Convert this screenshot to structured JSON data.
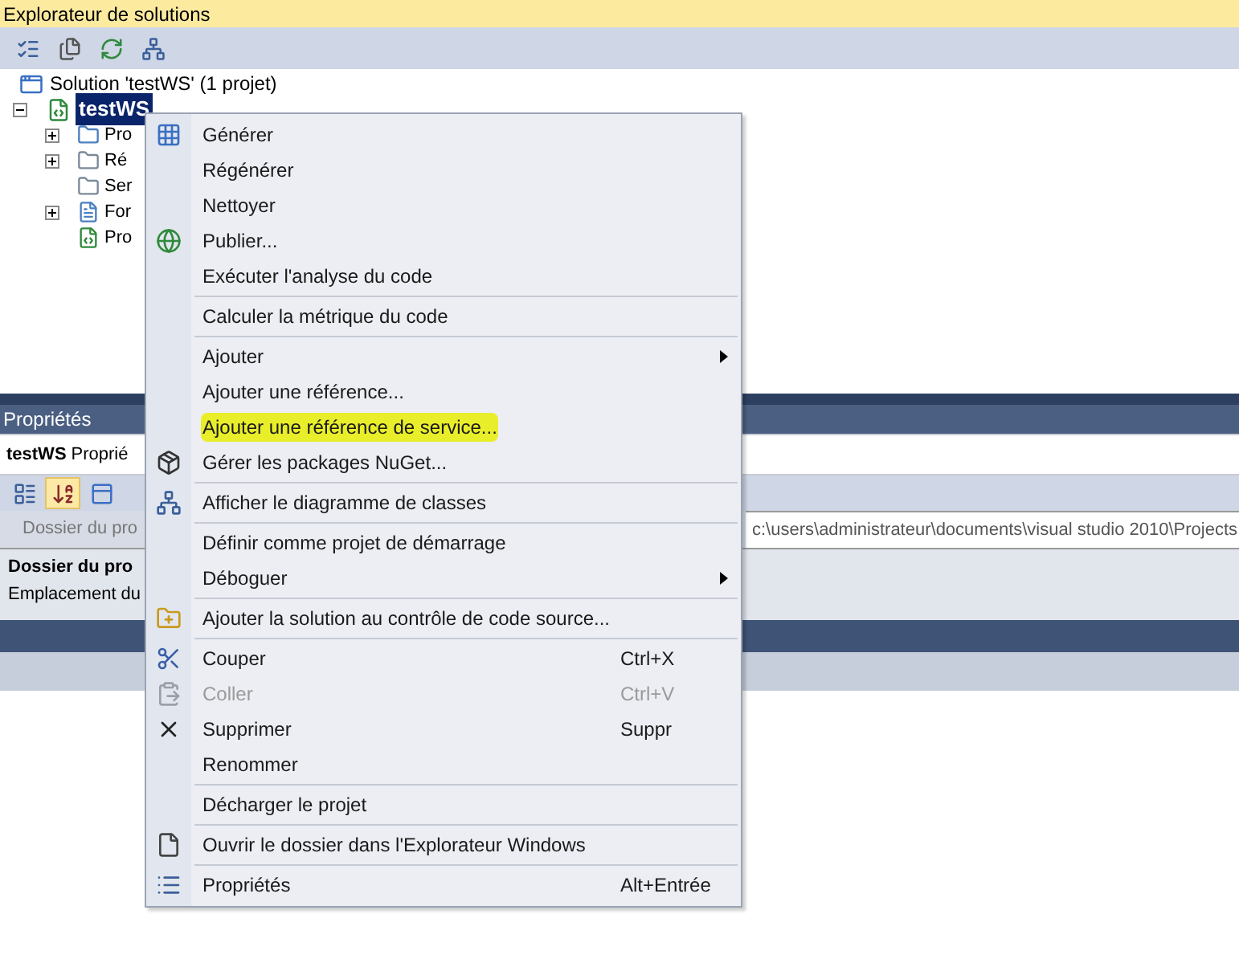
{
  "explorer": {
    "title": "Explorateur de solutions",
    "tree": {
      "label": "Solution 'testWS' (1 projet)",
      "children": [
        {
          "label": "testWS",
          "selected": true,
          "expanded": true,
          "children": [
            {
              "label": "Pro",
              "expanded": false
            },
            {
              "label": "Ré",
              "expanded": false
            },
            {
              "label": "Ser"
            },
            {
              "label": "For",
              "expanded": false
            },
            {
              "label": "Pro"
            }
          ]
        }
      ]
    }
  },
  "properties": {
    "title": "Propriétés",
    "object_name": "testWS",
    "object_type": "Proprié",
    "sort_buttons": [
      {
        "selected": false
      },
      {
        "selected": true
      }
    ],
    "row": {
      "name": "Dossier du pro",
      "value": "c:\\users\\administrateur\\documents\\visual studio 2010\\Projects"
    },
    "description": {
      "title": "Dossier du pro",
      "text": "Emplacement du"
    }
  },
  "context_menu": [
    {
      "kind": "item",
      "label": "Générer"
    },
    {
      "kind": "item",
      "label": "Régénérer"
    },
    {
      "kind": "item",
      "label": "Nettoyer"
    },
    {
      "kind": "item",
      "label": "Publier..."
    },
    {
      "kind": "item",
      "label": "Exécuter l'analyse du code"
    },
    {
      "kind": "separator"
    },
    {
      "kind": "item",
      "label": "Calculer la métrique du code"
    },
    {
      "kind": "separator"
    },
    {
      "kind": "item",
      "label": "Ajouter",
      "submenu": true
    },
    {
      "kind": "item",
      "label": "Ajouter une référence..."
    },
    {
      "kind": "item",
      "label": "Ajouter une référence de service...",
      "highlighted": true
    },
    {
      "kind": "item",
      "label": "Gérer les packages NuGet..."
    },
    {
      "kind": "separator"
    },
    {
      "kind": "item",
      "label": "Afficher le diagramme de classes"
    },
    {
      "kind": "separator"
    },
    {
      "kind": "item",
      "label": "Définir comme projet de démarrage"
    },
    {
      "kind": "item",
      "label": "Déboguer",
      "submenu": true
    },
    {
      "kind": "separator"
    },
    {
      "kind": "item",
      "label": "Ajouter la solution au contrôle de code source..."
    },
    {
      "kind": "separator"
    },
    {
      "kind": "item",
      "label": "Couper",
      "shortcut": "Ctrl+X"
    },
    {
      "kind": "item",
      "label": "Coller",
      "shortcut": "Ctrl+V",
      "disabled": true
    },
    {
      "kind": "item",
      "label": "Supprimer",
      "shortcut": "Suppr"
    },
    {
      "kind": "item",
      "label": "Renommer"
    },
    {
      "kind": "separator"
    },
    {
      "kind": "item",
      "label": "Décharger le projet"
    },
    {
      "kind": "separator"
    },
    {
      "kind": "item",
      "label": "Ouvrir le dossier dans l'Explorateur Windows"
    },
    {
      "kind": "separator"
    },
    {
      "kind": "item",
      "label": "Propriétés",
      "shortcut": "Alt+Entrée"
    }
  ]
}
